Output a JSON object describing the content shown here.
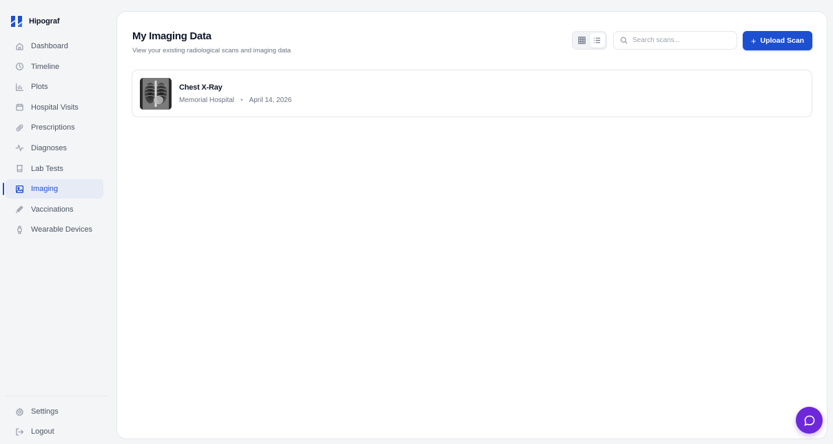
{
  "app": {
    "name": "Hipograf",
    "brand_color": "#1d4fd1",
    "logo_icon": "hipograf-logo-icon"
  },
  "sidebar": {
    "items": [
      {
        "label": "Dashboard",
        "icon": "home-icon"
      },
      {
        "label": "Timeline",
        "icon": "clock-icon"
      },
      {
        "label": "Plots",
        "icon": "bar-chart-icon"
      },
      {
        "label": "Hospital Visits",
        "icon": "calendar-icon"
      },
      {
        "label": "Prescriptions",
        "icon": "pill-icon"
      },
      {
        "label": "Diagnoses",
        "icon": "activity-icon"
      },
      {
        "label": "Lab Tests",
        "icon": "test-tube-icon"
      },
      {
        "label": "Imaging",
        "icon": "image-icon",
        "active": true
      },
      {
        "label": "Vaccinations",
        "icon": "syringe-icon"
      },
      {
        "label": "Wearable Devices",
        "icon": "watch-icon"
      }
    ],
    "bottom": [
      {
        "label": "Settings",
        "icon": "gear-icon"
      },
      {
        "label": "Logout",
        "icon": "logout-icon"
      }
    ]
  },
  "main": {
    "title": "My Imaging Data",
    "subtitle": "View your existing radiological scans and imaging data",
    "view_toggle": {
      "grid_icon": "grid-icon",
      "list_icon": "list-icon",
      "selected": "list"
    },
    "search": {
      "placeholder": "Search scans...",
      "value": ""
    },
    "upload_button": {
      "plus": "+",
      "label": "Upload Scan"
    },
    "scans": [
      {
        "title": "Chest X-Ray",
        "hospital": "Memorial Hospital",
        "separator": "•",
        "date": "April 14, 2026",
        "thumbnail": "chest-xray-thumbnail"
      }
    ]
  },
  "chat": {
    "icon": "chat-bubble-icon",
    "color": "#6d28d9"
  }
}
